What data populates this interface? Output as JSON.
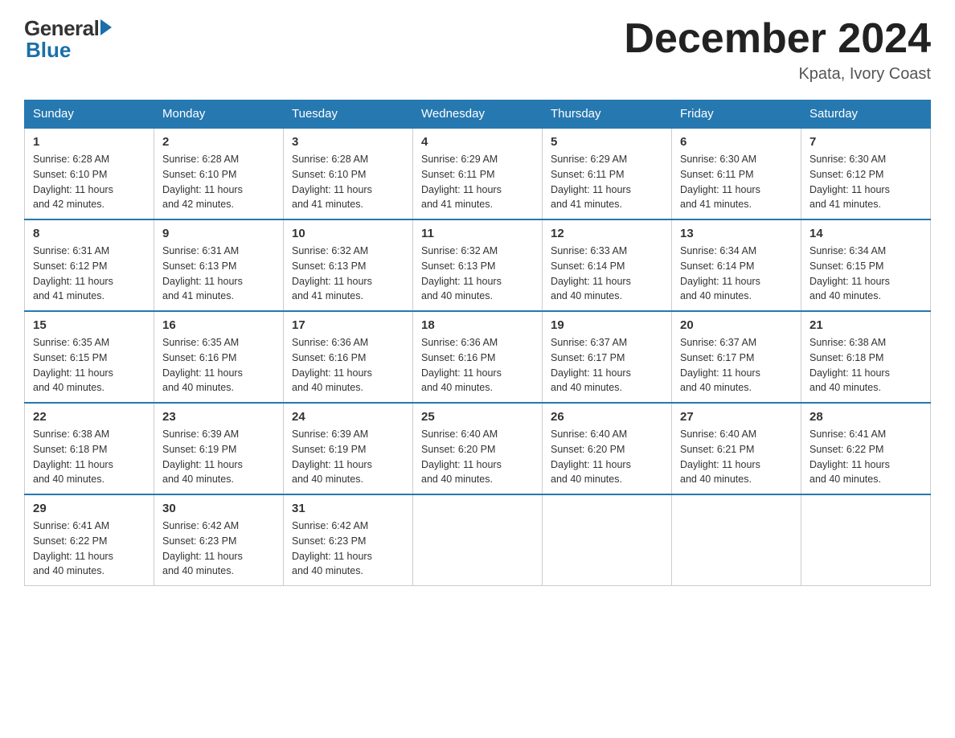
{
  "logo": {
    "general": "General",
    "blue": "Blue"
  },
  "title": "December 2024",
  "location": "Kpata, Ivory Coast",
  "days_of_week": [
    "Sunday",
    "Monday",
    "Tuesday",
    "Wednesday",
    "Thursday",
    "Friday",
    "Saturday"
  ],
  "weeks": [
    [
      {
        "day": "1",
        "sunrise": "6:28 AM",
        "sunset": "6:10 PM",
        "daylight": "11 hours and 42 minutes."
      },
      {
        "day": "2",
        "sunrise": "6:28 AM",
        "sunset": "6:10 PM",
        "daylight": "11 hours and 42 minutes."
      },
      {
        "day": "3",
        "sunrise": "6:28 AM",
        "sunset": "6:10 PM",
        "daylight": "11 hours and 41 minutes."
      },
      {
        "day": "4",
        "sunrise": "6:29 AM",
        "sunset": "6:11 PM",
        "daylight": "11 hours and 41 minutes."
      },
      {
        "day": "5",
        "sunrise": "6:29 AM",
        "sunset": "6:11 PM",
        "daylight": "11 hours and 41 minutes."
      },
      {
        "day": "6",
        "sunrise": "6:30 AM",
        "sunset": "6:11 PM",
        "daylight": "11 hours and 41 minutes."
      },
      {
        "day": "7",
        "sunrise": "6:30 AM",
        "sunset": "6:12 PM",
        "daylight": "11 hours and 41 minutes."
      }
    ],
    [
      {
        "day": "8",
        "sunrise": "6:31 AM",
        "sunset": "6:12 PM",
        "daylight": "11 hours and 41 minutes."
      },
      {
        "day": "9",
        "sunrise": "6:31 AM",
        "sunset": "6:13 PM",
        "daylight": "11 hours and 41 minutes."
      },
      {
        "day": "10",
        "sunrise": "6:32 AM",
        "sunset": "6:13 PM",
        "daylight": "11 hours and 41 minutes."
      },
      {
        "day": "11",
        "sunrise": "6:32 AM",
        "sunset": "6:13 PM",
        "daylight": "11 hours and 40 minutes."
      },
      {
        "day": "12",
        "sunrise": "6:33 AM",
        "sunset": "6:14 PM",
        "daylight": "11 hours and 40 minutes."
      },
      {
        "day": "13",
        "sunrise": "6:34 AM",
        "sunset": "6:14 PM",
        "daylight": "11 hours and 40 minutes."
      },
      {
        "day": "14",
        "sunrise": "6:34 AM",
        "sunset": "6:15 PM",
        "daylight": "11 hours and 40 minutes."
      }
    ],
    [
      {
        "day": "15",
        "sunrise": "6:35 AM",
        "sunset": "6:15 PM",
        "daylight": "11 hours and 40 minutes."
      },
      {
        "day": "16",
        "sunrise": "6:35 AM",
        "sunset": "6:16 PM",
        "daylight": "11 hours and 40 minutes."
      },
      {
        "day": "17",
        "sunrise": "6:36 AM",
        "sunset": "6:16 PM",
        "daylight": "11 hours and 40 minutes."
      },
      {
        "day": "18",
        "sunrise": "6:36 AM",
        "sunset": "6:16 PM",
        "daylight": "11 hours and 40 minutes."
      },
      {
        "day": "19",
        "sunrise": "6:37 AM",
        "sunset": "6:17 PM",
        "daylight": "11 hours and 40 minutes."
      },
      {
        "day": "20",
        "sunrise": "6:37 AM",
        "sunset": "6:17 PM",
        "daylight": "11 hours and 40 minutes."
      },
      {
        "day": "21",
        "sunrise": "6:38 AM",
        "sunset": "6:18 PM",
        "daylight": "11 hours and 40 minutes."
      }
    ],
    [
      {
        "day": "22",
        "sunrise": "6:38 AM",
        "sunset": "6:18 PM",
        "daylight": "11 hours and 40 minutes."
      },
      {
        "day": "23",
        "sunrise": "6:39 AM",
        "sunset": "6:19 PM",
        "daylight": "11 hours and 40 minutes."
      },
      {
        "day": "24",
        "sunrise": "6:39 AM",
        "sunset": "6:19 PM",
        "daylight": "11 hours and 40 minutes."
      },
      {
        "day": "25",
        "sunrise": "6:40 AM",
        "sunset": "6:20 PM",
        "daylight": "11 hours and 40 minutes."
      },
      {
        "day": "26",
        "sunrise": "6:40 AM",
        "sunset": "6:20 PM",
        "daylight": "11 hours and 40 minutes."
      },
      {
        "day": "27",
        "sunrise": "6:40 AM",
        "sunset": "6:21 PM",
        "daylight": "11 hours and 40 minutes."
      },
      {
        "day": "28",
        "sunrise": "6:41 AM",
        "sunset": "6:22 PM",
        "daylight": "11 hours and 40 minutes."
      }
    ],
    [
      {
        "day": "29",
        "sunrise": "6:41 AM",
        "sunset": "6:22 PM",
        "daylight": "11 hours and 40 minutes."
      },
      {
        "day": "30",
        "sunrise": "6:42 AM",
        "sunset": "6:23 PM",
        "daylight": "11 hours and 40 minutes."
      },
      {
        "day": "31",
        "sunrise": "6:42 AM",
        "sunset": "6:23 PM",
        "daylight": "11 hours and 40 minutes."
      },
      null,
      null,
      null,
      null
    ]
  ],
  "labels": {
    "sunrise": "Sunrise:",
    "sunset": "Sunset:",
    "daylight": "Daylight:"
  }
}
